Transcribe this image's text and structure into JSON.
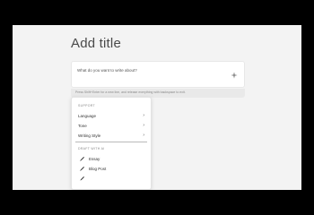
{
  "editor": {
    "title": "Add title",
    "prompt_placeholder": "What do you want to write about?",
    "hint": "Press Shift+Enter for a new line, and release everything with backspace to exit."
  },
  "menu": {
    "support_title": "SUPPORT",
    "support_items": [
      {
        "label": "Language",
        "chevron": "›"
      },
      {
        "label": "Tone",
        "chevron": "›"
      },
      {
        "label": "Writing Style",
        "chevron": "›"
      }
    ],
    "draft_title": "DRAFT WITH AI",
    "draft_items": [
      {
        "label": "Essay",
        "icon": "pen-icon"
      },
      {
        "label": "Blog Post",
        "icon": "pen-icon"
      }
    ]
  },
  "colors": {
    "background": "#f3f3f3",
    "letterbox": "#000000",
    "accent": "#333333"
  }
}
